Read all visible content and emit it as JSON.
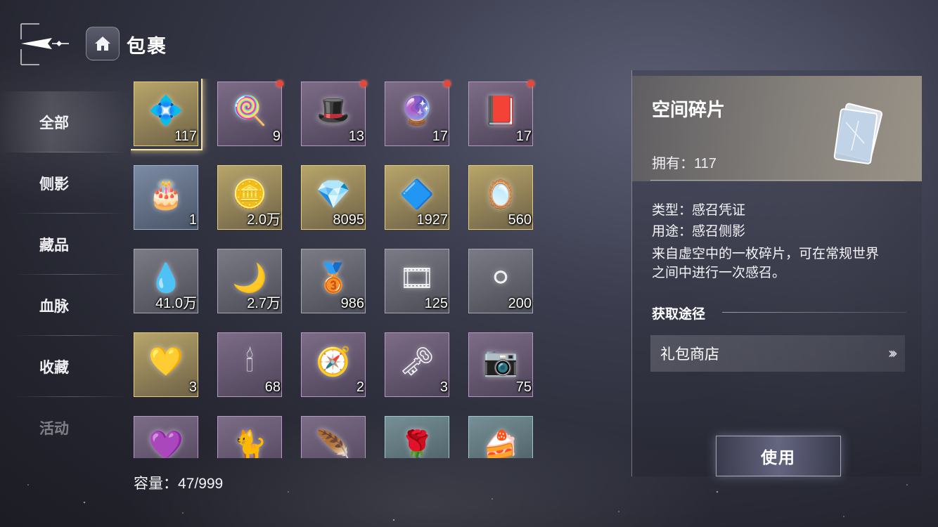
{
  "header": {
    "title": "包裹",
    "back_icon": "back-arrow-icon",
    "home_icon": "home-icon"
  },
  "tabs": [
    {
      "label": "全部",
      "active": true
    },
    {
      "label": "侧影",
      "active": false
    },
    {
      "label": "藏品",
      "active": false
    },
    {
      "label": "血脉",
      "active": false
    },
    {
      "label": "收藏",
      "active": false
    },
    {
      "label": "活动",
      "active": false
    }
  ],
  "items": [
    {
      "qty": "117",
      "rarity": "gold",
      "icon": "💠",
      "selected": true,
      "dot": false
    },
    {
      "qty": "9",
      "rarity": "purple",
      "icon": "🍭",
      "dot": true
    },
    {
      "qty": "13",
      "rarity": "purple",
      "icon": "🎩",
      "dot": true
    },
    {
      "qty": "17",
      "rarity": "purple",
      "icon": "🔮",
      "dot": true
    },
    {
      "qty": "17",
      "rarity": "purple",
      "icon": "📕",
      "dot": true
    },
    {
      "qty": "1",
      "rarity": "blue",
      "icon": "🎂",
      "dot": false
    },
    {
      "qty": "2.0万",
      "rarity": "gold",
      "icon": "🪙",
      "dot": false
    },
    {
      "qty": "8095",
      "rarity": "gold",
      "icon": "💎",
      "dot": false
    },
    {
      "qty": "1927",
      "rarity": "gold",
      "icon": "🔷",
      "dot": false
    },
    {
      "qty": "560",
      "rarity": "gold",
      "icon": "🪞",
      "dot": false
    },
    {
      "qty": "41.0万",
      "rarity": "gray",
      "icon": "💧",
      "dot": false
    },
    {
      "qty": "2.7万",
      "rarity": "gray",
      "icon": "🌙",
      "dot": false
    },
    {
      "qty": "986",
      "rarity": "gray",
      "icon": "🥉",
      "dot": false
    },
    {
      "qty": "125",
      "rarity": "gray",
      "icon": "🎞",
      "dot": false
    },
    {
      "qty": "200",
      "rarity": "gray",
      "icon": "⚪",
      "dot": false
    },
    {
      "qty": "3",
      "rarity": "gold",
      "icon": "💛",
      "dot": false
    },
    {
      "qty": "68",
      "rarity": "purple",
      "icon": "🕯",
      "dot": false
    },
    {
      "qty": "2",
      "rarity": "purple",
      "icon": "🧭",
      "dot": false
    },
    {
      "qty": "3",
      "rarity": "purple",
      "icon": "🗝",
      "dot": false
    },
    {
      "qty": "75",
      "rarity": "purple",
      "icon": "📷",
      "dot": false
    },
    {
      "qty": "",
      "rarity": "purple",
      "icon": "💜",
      "dot": false
    },
    {
      "qty": "",
      "rarity": "purple",
      "icon": "🐈",
      "dot": false
    },
    {
      "qty": "",
      "rarity": "purple",
      "icon": "🪶",
      "dot": false
    },
    {
      "qty": "",
      "rarity": "teal",
      "icon": "🌹",
      "dot": false
    },
    {
      "qty": "",
      "rarity": "teal",
      "icon": "🍰",
      "dot": false
    }
  ],
  "capacity": "容量：47/999",
  "detail": {
    "name": "空间碎片",
    "own": "拥有：117",
    "type": "类型：感召凭证",
    "usage": "用途：感召侧影",
    "description": "来自虚空中的一枚碎片，可在常规世界之间中进行一次感召。",
    "source_title": "获取途径",
    "source_item": "礼包商店",
    "source_icon": "double-chevron-right-icon"
  },
  "use_button": "使用",
  "colors": {
    "rarity_gold": "#e6cf7a",
    "rarity_purple": "#b79ac4",
    "rarity_blue": "#9fb4cf",
    "notification_dot": "#e4483c"
  }
}
